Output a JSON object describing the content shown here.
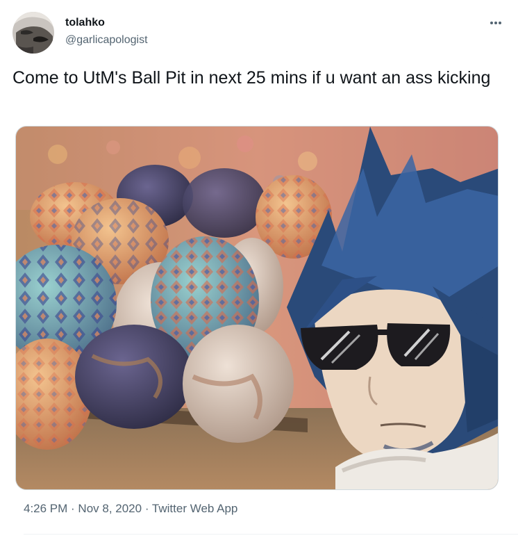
{
  "author": {
    "display_name": "tolahko",
    "handle": "@garlicapologist"
  },
  "tweet": {
    "text": "Come to UtM's Ball Pit in next 25 mins if u want an ass kicking"
  },
  "meta": {
    "time": "4:26 PM",
    "separator": " · ",
    "date": "Nov 8, 2020",
    "source": "Twitter Web App"
  },
  "icons": {
    "more": "more-horizontal-icon"
  },
  "colors": {
    "text_primary": "#0f1419",
    "text_secondary": "#536471",
    "border": "#cfd9de",
    "divider": "#eff3f4"
  }
}
